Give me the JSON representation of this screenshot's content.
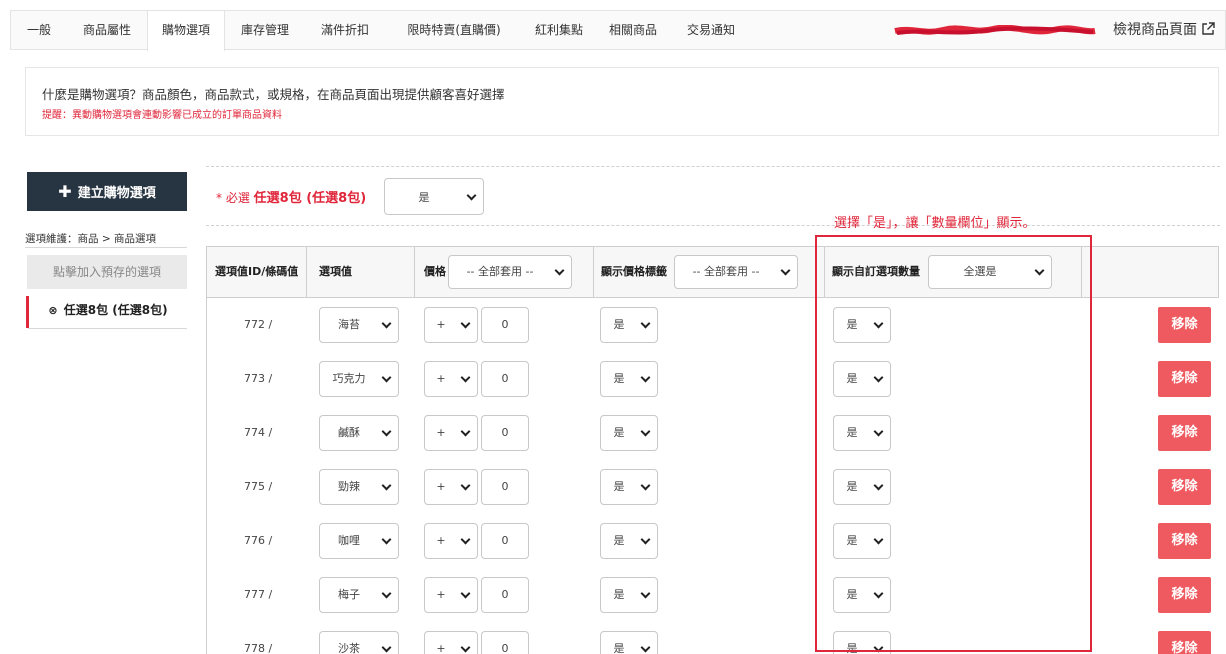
{
  "tabs": [
    "一般",
    "商品屬性",
    "購物選項",
    "庫存管理",
    "滿件折扣",
    "限時特賣(直購價)",
    "紅利集點",
    "相關商品",
    "交易通知"
  ],
  "active_tab": "購物選項",
  "view_link": "檢視商品頁面",
  "info": {
    "title": "什麼是購物選項？商品顏色，商品款式，或規格，在商品頁面出現提供顧客喜好選擇",
    "note": "提醒：異動購物選項會連動影響已成立的訂單商品資料"
  },
  "sidebar": {
    "create_button": "建立購物選項",
    "maintenance": "選項維護：商品 > 商品選項",
    "preset_button": "點擊加入預存的選項",
    "item_label": "任選8包 (任選8包)"
  },
  "required": {
    "prefix": "* 必選",
    "name": "任選8包 (任選8包)",
    "value": "是"
  },
  "annotation": "選擇「是」，讓「數量欄位」顯示。",
  "table": {
    "headers": {
      "id": "選項值ID/條碼值",
      "value": "選項值",
      "price": "價格",
      "price_select": "-- 全部套用 --",
      "show_tag": "顯示價格標籤",
      "show_tag_select": "-- 全部套用 --",
      "show_qty": "顯示自訂選項數量",
      "show_qty_select": "全選是"
    },
    "rows": [
      {
        "id": "772 /",
        "value": "海苔",
        "sign": "+",
        "price": "0",
        "tag": "是",
        "qty": "是",
        "action": "移除"
      },
      {
        "id": "773 /",
        "value": "巧克力",
        "sign": "+",
        "price": "0",
        "tag": "是",
        "qty": "是",
        "action": "移除"
      },
      {
        "id": "774 /",
        "value": "鹹酥",
        "sign": "+",
        "price": "0",
        "tag": "是",
        "qty": "是",
        "action": "移除"
      },
      {
        "id": "775 /",
        "value": "勁辣",
        "sign": "+",
        "price": "0",
        "tag": "是",
        "qty": "是",
        "action": "移除"
      },
      {
        "id": "776 /",
        "value": "咖哩",
        "sign": "+",
        "price": "0",
        "tag": "是",
        "qty": "是",
        "action": "移除"
      },
      {
        "id": "777 /",
        "value": "梅子",
        "sign": "+",
        "price": "0",
        "tag": "是",
        "qty": "是",
        "action": "移除"
      },
      {
        "id": "778 /",
        "value": "沙茶",
        "sign": "+",
        "price": "0",
        "tag": "是",
        "qty": "是",
        "action": "移除"
      }
    ]
  },
  "colors": {
    "accent": "#e0263a",
    "dark_button": "#273542",
    "remove_button": "#ee5a5f"
  }
}
